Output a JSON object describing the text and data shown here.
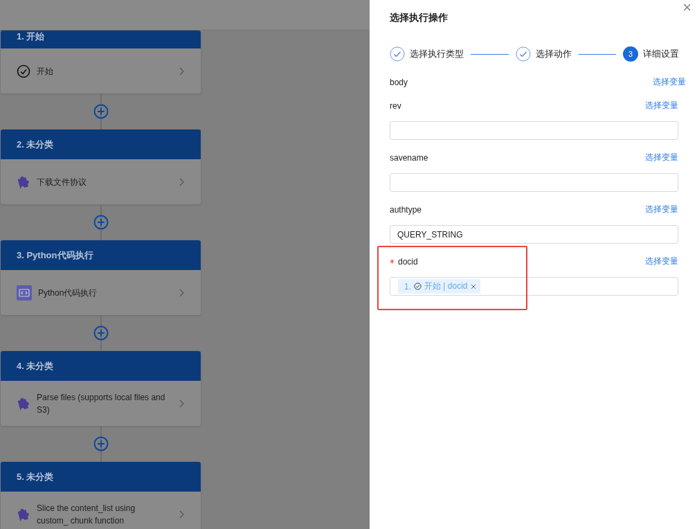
{
  "flow": {
    "steps": [
      {
        "title": "1. 开始",
        "kind": "start",
        "label": "开始"
      },
      {
        "title": "2. 未分类",
        "kind": "plugin",
        "label": "下载文件协议"
      },
      {
        "title": "3. Python代码执行",
        "kind": "code",
        "label": "Python代码执行"
      },
      {
        "title": "4. 未分类",
        "kind": "plugin",
        "label": "Parse files (supports local files and S3)"
      },
      {
        "title": "5. 未分类",
        "kind": "plugin",
        "label": "Slice the content_list using custom_ chunk function"
      }
    ]
  },
  "drawer": {
    "title": "选择执行操作",
    "close": "×",
    "steps": [
      {
        "kind": "done",
        "label": "选择执行类型"
      },
      {
        "kind": "done",
        "label": "选择动作"
      },
      {
        "kind": "current",
        "number": "3",
        "label": "详细设置"
      }
    ],
    "fields": [
      {
        "kind": "label-only",
        "label": "body",
        "required": false,
        "highlighted": false,
        "link": "选择变量"
      },
      {
        "kind": "input",
        "label": "rev",
        "required": false,
        "highlighted": false,
        "link": "选择变量"
      },
      {
        "kind": "input",
        "label": "savename",
        "required": false,
        "highlighted": false,
        "link": "选择变量"
      },
      {
        "kind": "input",
        "label": "authtype",
        "required": false,
        "highlighted": false,
        "link": "选择变量",
        "value": "QUERY_STRING"
      },
      {
        "kind": "tags",
        "label": "docid",
        "required": true,
        "highlighted": true,
        "link": "选择变量",
        "tags": [
          {
            "index": "1.",
            "text": "开始 | docid"
          }
        ]
      }
    ]
  }
}
